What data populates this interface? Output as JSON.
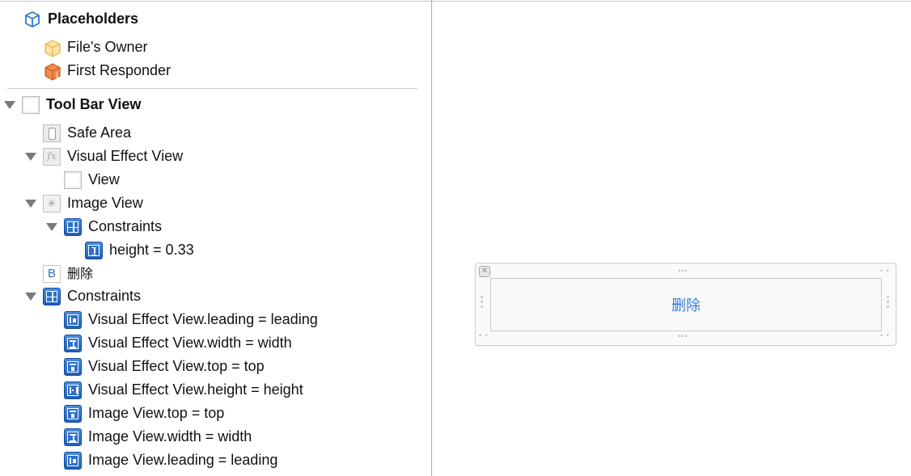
{
  "outline": {
    "placeholders_header": "Placeholders",
    "placeholders": [
      {
        "label": "File's Owner",
        "icon": "files-owner-cube-icon",
        "color": "#f5c964"
      },
      {
        "label": "First Responder",
        "icon": "first-responder-cube-icon",
        "color": "#e8743b"
      }
    ],
    "tree": [
      {
        "label": "Tool Bar View",
        "icon": "view-icon",
        "expanded": true
      },
      {
        "label": "Safe Area",
        "icon": "safe-area-icon"
      },
      {
        "label": "Visual Effect View",
        "icon": "visual-effect-icon",
        "expanded": true
      },
      {
        "label": "View",
        "icon": "view-icon"
      },
      {
        "label": "Image View",
        "icon": "image-view-icon",
        "expanded": true
      },
      {
        "label": "Constraints",
        "icon": "constraints-icon",
        "expanded": true
      },
      {
        "label": "height = 0.33",
        "icon": "height-constraint-icon"
      },
      {
        "label": "删除",
        "icon": "button-icon",
        "icon_text": "B"
      },
      {
        "label": "Constraints",
        "icon": "constraints-icon",
        "expanded": true
      },
      {
        "label": "Visual Effect View.leading = leading",
        "icon": "leading-constraint-icon"
      },
      {
        "label": "Visual Effect View.width = width",
        "icon": "width-constraint-icon"
      },
      {
        "label": "Visual Effect View.top = top",
        "icon": "top-constraint-icon"
      },
      {
        "label": "Visual Effect View.height = height",
        "icon": "height-constraint-icon"
      },
      {
        "label": "Image View.top = top",
        "icon": "top-constraint-icon"
      },
      {
        "label": "Image View.width = width",
        "icon": "width-constraint-icon"
      },
      {
        "label": "Image View.leading = leading",
        "icon": "leading-constraint-icon"
      }
    ]
  },
  "canvas": {
    "button_title": "删除",
    "button_color": "#3479d5"
  }
}
